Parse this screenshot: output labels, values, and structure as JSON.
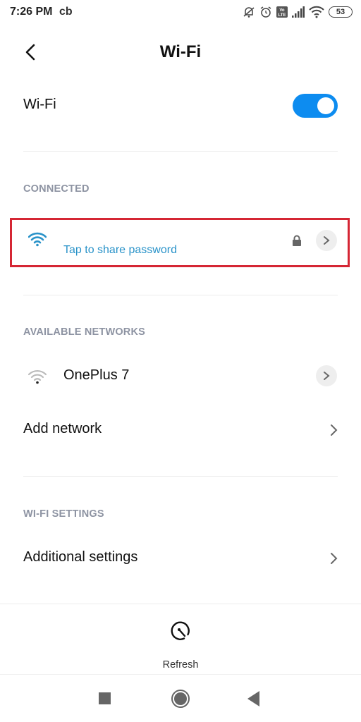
{
  "status_bar": {
    "time": "7:26 PM",
    "carrier": "cb",
    "battery_level": "53",
    "icons": [
      "notifications-muted-icon",
      "alarm-icon",
      "volte-icon",
      "cell-signal-icon",
      "wifi-signal-icon",
      "battery-icon"
    ]
  },
  "header": {
    "back_icon": "chevron-left-icon",
    "title": "Wi-Fi"
  },
  "wifi_toggle": {
    "label": "Wi-Fi",
    "enabled": true,
    "accent_color": "#0d8cf0"
  },
  "connected_section": {
    "heading": "CONNECTED",
    "network": {
      "name": "",
      "subtitle": "Tap to share password",
      "secured": true,
      "signal_icon": "wifi-full-icon",
      "color": "#2a93c9",
      "highlight_color": "#d52634"
    }
  },
  "available_section": {
    "heading": "AVAILABLE NETWORKS",
    "networks": [
      {
        "name": "OnePlus 7",
        "signal_icon": "wifi-weak-icon",
        "secured": false
      }
    ],
    "add_network_label": "Add network"
  },
  "settings_section": {
    "heading": "WI-FI SETTINGS",
    "items": [
      {
        "label": "Additional settings"
      }
    ]
  },
  "bottom_bar": {
    "refresh_label": "Refresh",
    "refresh_icon": "refresh-icon"
  },
  "nav_bar": {
    "buttons": [
      "recents-button",
      "home-button",
      "back-button"
    ]
  }
}
